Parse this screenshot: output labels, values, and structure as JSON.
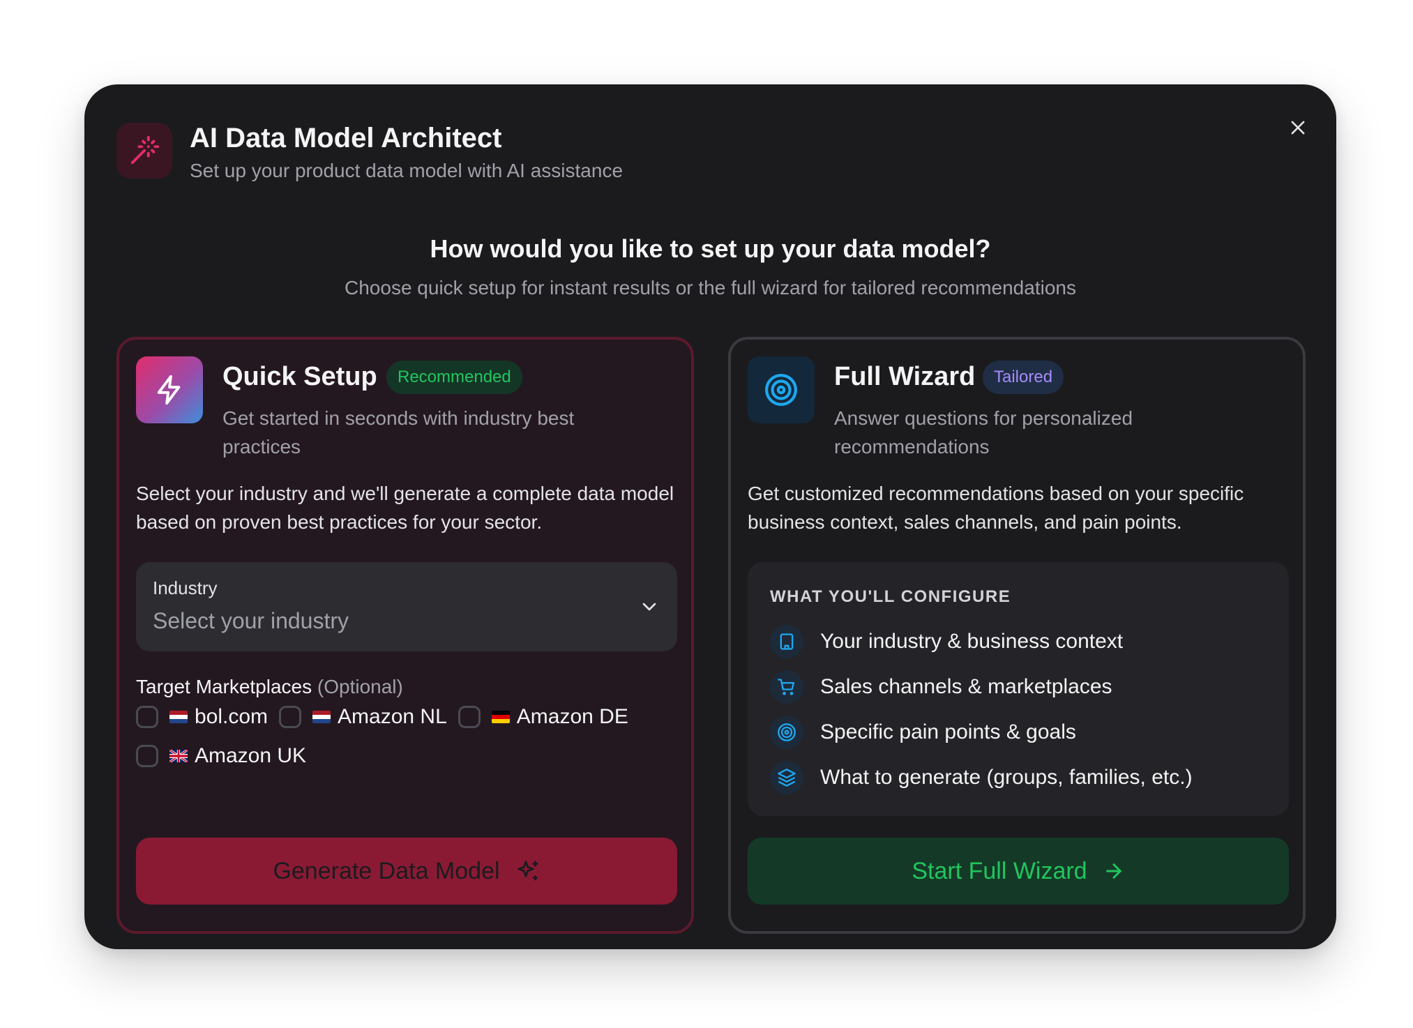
{
  "header": {
    "title": "AI Data Model Architect",
    "subtitle": "Set up your product data model with AI assistance",
    "icon": "magic-wand-icon",
    "close_icon": "close-icon"
  },
  "question": {
    "title": "How would you like to set up your data model?",
    "subtitle": "Choose quick setup for instant results or the full wizard for tailored recommendations"
  },
  "quick_setup": {
    "title": "Quick Setup",
    "badge": "Recommended",
    "subtitle": "Get started in seconds with industry best practices",
    "description": "Select your industry and we'll generate a complete data model based on proven best practices for your sector.",
    "industry_select": {
      "label": "Industry",
      "placeholder": "Select your industry"
    },
    "marketplaces": {
      "title": "Target Marketplaces",
      "optional": "(Optional)",
      "items": [
        {
          "label": "bol.com",
          "flag": "NL",
          "checked": false
        },
        {
          "label": "Amazon NL",
          "flag": "NL",
          "checked": false
        },
        {
          "label": "Amazon DE",
          "flag": "DE",
          "checked": false
        },
        {
          "label": "Amazon UK",
          "flag": "UK",
          "checked": false
        }
      ]
    },
    "button_label": "Generate Data Model",
    "button_icon": "sparkles-icon",
    "accent": "#e22d6b"
  },
  "full_wizard": {
    "title": "Full Wizard",
    "badge": "Tailored",
    "subtitle": "Answer questions for personalized recommendations",
    "description": "Get customized recommendations based on your specific business context, sales channels, and pain points.",
    "configure": {
      "title": "WHAT YOU'LL CONFIGURE",
      "items": [
        {
          "label": "Your industry & business context",
          "icon": "building-icon"
        },
        {
          "label": "Sales channels & marketplaces",
          "icon": "shopping-cart-icon"
        },
        {
          "label": "Specific pain points & goals",
          "icon": "target-icon"
        },
        {
          "label": "What to generate (groups, families, etc.)",
          "icon": "layers-icon"
        }
      ]
    },
    "button_label": "Start Full Wizard",
    "button_icon": "arrow-right-icon",
    "accent": "#22c55e"
  }
}
